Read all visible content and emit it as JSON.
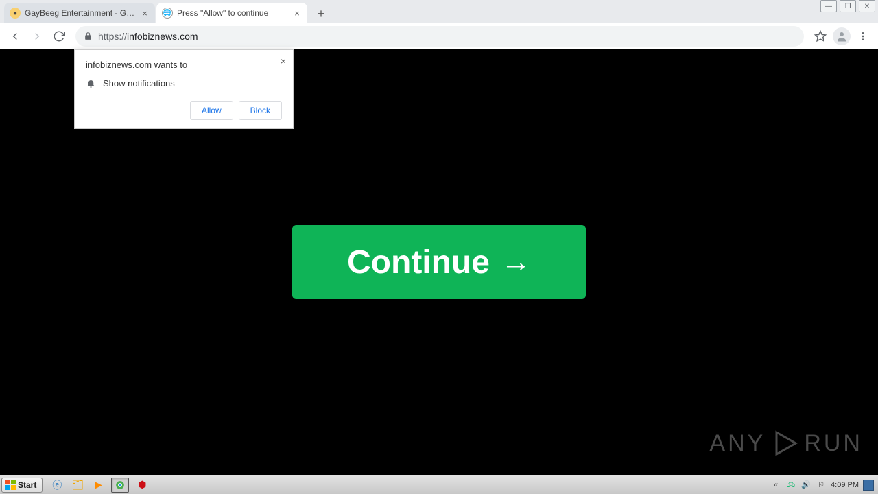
{
  "window_controls": {
    "minimize": "—",
    "maximize": "❐",
    "close": "✕"
  },
  "tabs": [
    {
      "title": "GayBeeg Entertainment - Gay Porn E",
      "active": false
    },
    {
      "title": "Press \"Allow\" to continue",
      "active": true
    }
  ],
  "toolbar": {
    "url_prefix": "https://",
    "url_host": "infobiznews.com"
  },
  "permission": {
    "origin_line": "infobiznews.com wants to",
    "request": "Show notifications",
    "allow": "Allow",
    "block": "Block"
  },
  "page": {
    "continue_label": "Continue"
  },
  "watermark": {
    "left": "ANY",
    "right": "RUN"
  },
  "taskbar": {
    "start": "Start",
    "clock": "4:09 PM"
  }
}
